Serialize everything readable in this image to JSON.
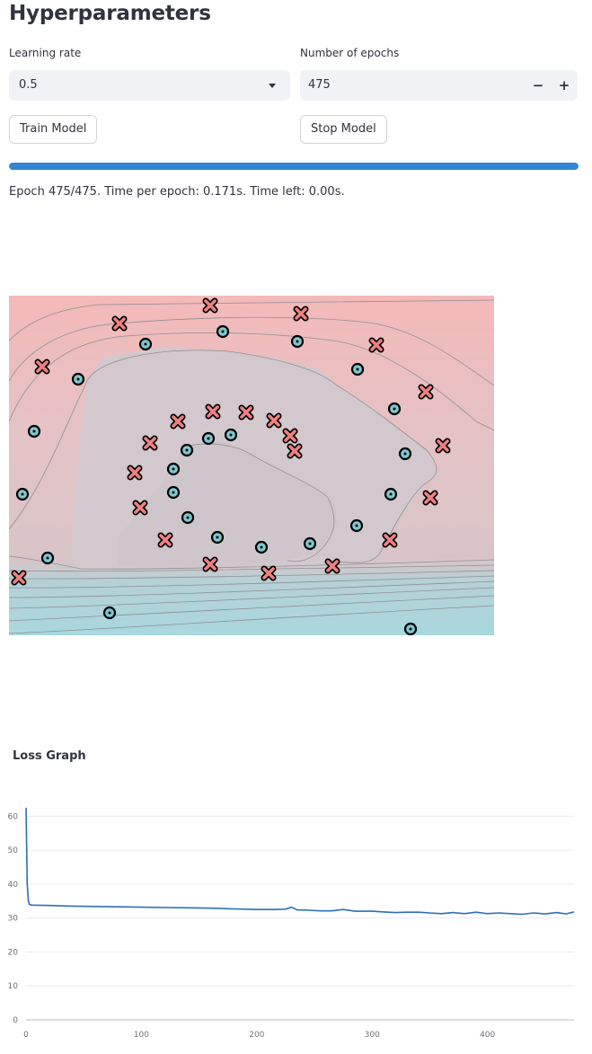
{
  "page": {
    "title": "Hyperparameters"
  },
  "controls": {
    "learning_rate": {
      "label": "Learning rate",
      "value": "0.5"
    },
    "epochs": {
      "label": "Number of epochs",
      "value": "475",
      "minus": "−",
      "plus": "+"
    },
    "train_label": "Train Model",
    "stop_label": "Stop Model"
  },
  "progress": {
    "fraction": 1.0
  },
  "status": {
    "text": "Epoch 475/475. Time per epoch: 0.171s. Time left: 0.00s."
  },
  "decision_plot": {
    "colors": {
      "class_x": "#f08080",
      "class_o": "#7ec8d0",
      "region_x": "#f2b8b8",
      "region_o": "#a8d8de",
      "inner": "#d3c8cd"
    }
  },
  "loss_chart": {
    "title": "Loss Graph",
    "color": "#2a6fb8"
  },
  "chart_data": [
    {
      "type": "scatter",
      "title": "",
      "xlabel": "",
      "ylabel": "",
      "grid": false,
      "x_range": [
        0,
        540
      ],
      "y_range": [
        0,
        378
      ],
      "series": [
        {
          "marker": "x",
          "color": "#f08080",
          "points": [
            [
              224,
              11
            ],
            [
              325,
              20
            ],
            [
              123,
              31
            ],
            [
              409,
              55
            ],
            [
              37,
              79
            ],
            [
              464,
              107
            ],
            [
              188,
              140
            ],
            [
              227,
              129
            ],
            [
              264,
              130
            ],
            [
              295,
              139
            ],
            [
              313,
              156
            ],
            [
              318,
              173
            ],
            [
              483,
              167
            ],
            [
              157,
              164
            ],
            [
              140,
              197
            ],
            [
              146,
              236
            ],
            [
              469,
              225
            ],
            [
              174,
              272
            ],
            [
              424,
              272
            ],
            [
              224,
              299
            ],
            [
              289,
              309
            ],
            [
              360,
              301
            ],
            [
              11,
              314
            ]
          ]
        },
        {
          "marker": "o",
          "color": "#7ec8d0",
          "points": [
            [
              238,
              40
            ],
            [
              152,
              54
            ],
            [
              321,
              51
            ],
            [
              388,
              82
            ],
            [
              77,
              93
            ],
            [
              429,
              126
            ],
            [
              28,
              151
            ],
            [
              247,
              155
            ],
            [
              222,
              159
            ],
            [
              198,
              172
            ],
            [
              441,
              176
            ],
            [
              183,
              193
            ],
            [
              183,
              219
            ],
            [
              15,
              221
            ],
            [
              425,
              221
            ],
            [
              199,
              247
            ],
            [
              387,
              256
            ],
            [
              232,
              269
            ],
            [
              281,
              280
            ],
            [
              335,
              276
            ],
            [
              43,
              292
            ],
            [
              112,
              353
            ],
            [
              447,
              371
            ]
          ]
        }
      ]
    },
    {
      "type": "line",
      "title": "Loss Graph",
      "xlabel": "",
      "ylabel": "",
      "grid": true,
      "xlim": [
        0,
        475
      ],
      "ylim": [
        0,
        63
      ],
      "x_ticks": [
        0,
        100,
        200,
        300,
        400
      ],
      "y_ticks": [
        0,
        10,
        20,
        30,
        40,
        50,
        60
      ],
      "series": [
        {
          "points": [
            [
              0,
              62.5
            ],
            [
              1,
              40
            ],
            [
              2,
              35
            ],
            [
              3,
              34
            ],
            [
              5,
              33.8
            ],
            [
              20,
              33.7
            ],
            [
              40,
              33.5
            ],
            [
              60,
              33.4
            ],
            [
              80,
              33.3
            ],
            [
              100,
              33.2
            ],
            [
              120,
              33.1
            ],
            [
              140,
              33
            ],
            [
              160,
              32.9
            ],
            [
              180,
              32.7
            ],
            [
              200,
              32.5
            ],
            [
              215,
              32.5
            ],
            [
              225,
              32.6
            ],
            [
              230,
              33.2
            ],
            [
              235,
              32.4
            ],
            [
              245,
              32.3
            ],
            [
              255,
              32.1
            ],
            [
              265,
              32.1
            ],
            [
              275,
              32.5
            ],
            [
              285,
              32
            ],
            [
              300,
              32
            ],
            [
              310,
              31.8
            ],
            [
              320,
              31.6
            ],
            [
              330,
              31.7
            ],
            [
              340,
              31.7
            ],
            [
              350,
              31.5
            ],
            [
              360,
              31.3
            ],
            [
              370,
              31.6
            ],
            [
              380,
              31.3
            ],
            [
              390,
              31.7
            ],
            [
              400,
              31.3
            ],
            [
              410,
              31.5
            ],
            [
              420,
              31.3
            ],
            [
              430,
              31.1
            ],
            [
              440,
              31.5
            ],
            [
              450,
              31.2
            ],
            [
              460,
              31.6
            ],
            [
              468,
              31.2
            ],
            [
              475,
              31.8
            ]
          ]
        }
      ]
    }
  ]
}
